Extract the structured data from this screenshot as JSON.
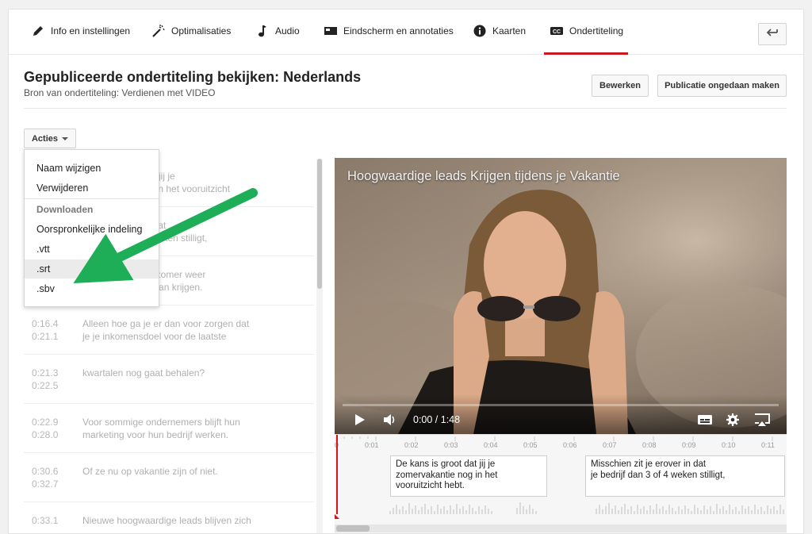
{
  "tabs": [
    {
      "label": "Info en instellingen",
      "icon": "pencil-icon"
    },
    {
      "label": "Optimalisaties",
      "icon": "magic-wand-icon"
    },
    {
      "label": "Audio",
      "icon": "music-note-icon"
    },
    {
      "label": "Eindscherm en annotaties",
      "icon": "end-screen-icon"
    },
    {
      "label": "Kaarten",
      "icon": "info-icon"
    },
    {
      "label": "Ondertiteling",
      "icon": "closed-captions-icon",
      "active": true
    }
  ],
  "header": {
    "title": "Gepubliceerde ondertiteling bekijken: Nederlands",
    "subtitle": "Bron van ondertiteling: Verdienen met VIDEO",
    "edit_label": "Bewerken",
    "unpublish_label": "Publicatie ongedaan maken"
  },
  "actions": {
    "label": "Acties",
    "menu": [
      {
        "label": "Naam wijzigen",
        "type": "item"
      },
      {
        "label": "Verwijderen",
        "type": "item"
      },
      {
        "label": "Downloaden",
        "type": "header"
      },
      {
        "label": "Oorspronkelijke indeling",
        "type": "item"
      },
      {
        "label": ".vtt",
        "type": "item"
      },
      {
        "label": ".srt",
        "type": "item",
        "highlighted": true
      },
      {
        "label": ".sbv",
        "type": "item"
      }
    ]
  },
  "captions": [
    {
      "start": "",
      "end": "",
      "text_line1": "dat jij je",
      "text_line2": "og in het vooruitzicht"
    },
    {
      "start": "",
      "end": "",
      "text_line1": "in dat",
      "text_line2": "4 weken stilligt,"
    },
    {
      "start": "",
      "end": "",
      "text_line1": "de zomer weer",
      "text_line2": "t gaan krijgen."
    },
    {
      "start": "0:16.4",
      "end": "0:21.1",
      "text_line1": "Alleen hoe ga je er dan voor zorgen dat",
      "text_line2": "je je inkomensdoel voor de laatste"
    },
    {
      "start": "0:21.3",
      "end": "0:22.5",
      "text_line1": "kwartalen nog gaat behalen?",
      "text_line2": ""
    },
    {
      "start": "0:22.9",
      "end": "0:28.0",
      "text_line1": "Voor sommige ondernemers blijft hun",
      "text_line2": "marketing voor hun bedrijf werken."
    },
    {
      "start": "0:30.6",
      "end": "0:32.7",
      "text_line1": "Of ze nu op vakantie zijn of niet.",
      "text_line2": ""
    },
    {
      "start": "0:33.1",
      "end": "",
      "text_line1": "Nieuwe hoogwaardige leads blijven zich",
      "text_line2": ""
    }
  ],
  "video": {
    "title": "Hoogwaardige leads Krijgen tijdens je Vakantie",
    "time": "0:00 / 1:48",
    "progress": 0
  },
  "timeline": {
    "ticks": [
      "0",
      "0:01",
      "0:02",
      "0:03",
      "0:04",
      "0:05",
      "0:06",
      "0:07",
      "0:08",
      "0:09",
      "0:10",
      "0:11"
    ],
    "caption_boxes": [
      {
        "line1": "De kans is groot dat jij je",
        "line2": "zomervakantie nog in het",
        "line3": "vooruitzicht hebt."
      },
      {
        "line1": "Misschien zit je erover in dat",
        "line2": "je bedrijf dan 3 of 4 weken stilligt,",
        "line3": ""
      }
    ]
  },
  "colors": {
    "accent": "#cc181e",
    "annotation_arrow": "#1eae57"
  }
}
